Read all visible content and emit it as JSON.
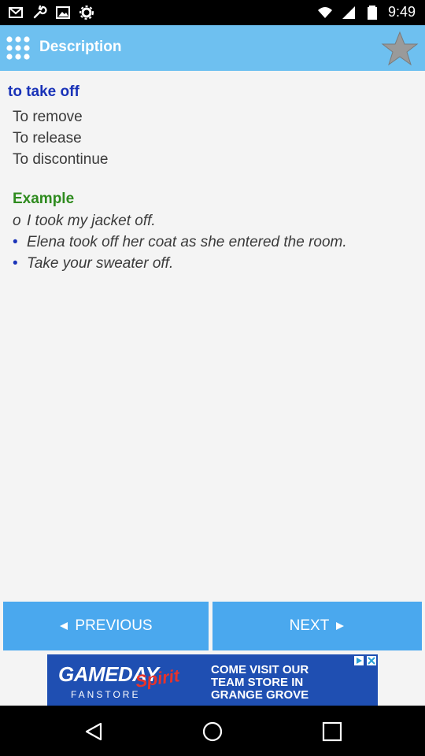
{
  "status_bar": {
    "time": "9:49",
    "left_icons": [
      "mail-icon",
      "wrench-icon",
      "image-icon",
      "gear-icon"
    ],
    "right_icons": [
      "wifi-icon",
      "signal-icon",
      "battery-icon"
    ]
  },
  "app_bar": {
    "title": "Description",
    "menu_icon": "grid-menu-icon",
    "favorite_icon": "star-icon"
  },
  "content": {
    "term": "to take off",
    "meanings": [
      "To remove",
      "To release",
      "To discontinue"
    ],
    "example_heading": "Example",
    "examples": [
      {
        "bullet": "o",
        "text": "I took my jacket off."
      },
      {
        "bullet": "•",
        "text": "Elena took off her coat as she entered the room."
      },
      {
        "bullet": "•",
        "text": "Take your sweater off."
      }
    ]
  },
  "navigation": {
    "previous_label": "PREVIOUS",
    "next_label": "NEXT"
  },
  "ad": {
    "brand": "GAMEDAY",
    "brand_script": "Spirit",
    "brand_sub": "FANSTORE",
    "lines": [
      "COME VISIT OUR",
      "TEAM STORE IN",
      "GRANGE GROVE"
    ]
  },
  "colors": {
    "app_bar": "#6ec0f0",
    "term": "#1a33b8",
    "example_heading": "#2e8b1e",
    "button": "#4aa8ee",
    "ad_background": "#1f4fb2"
  }
}
